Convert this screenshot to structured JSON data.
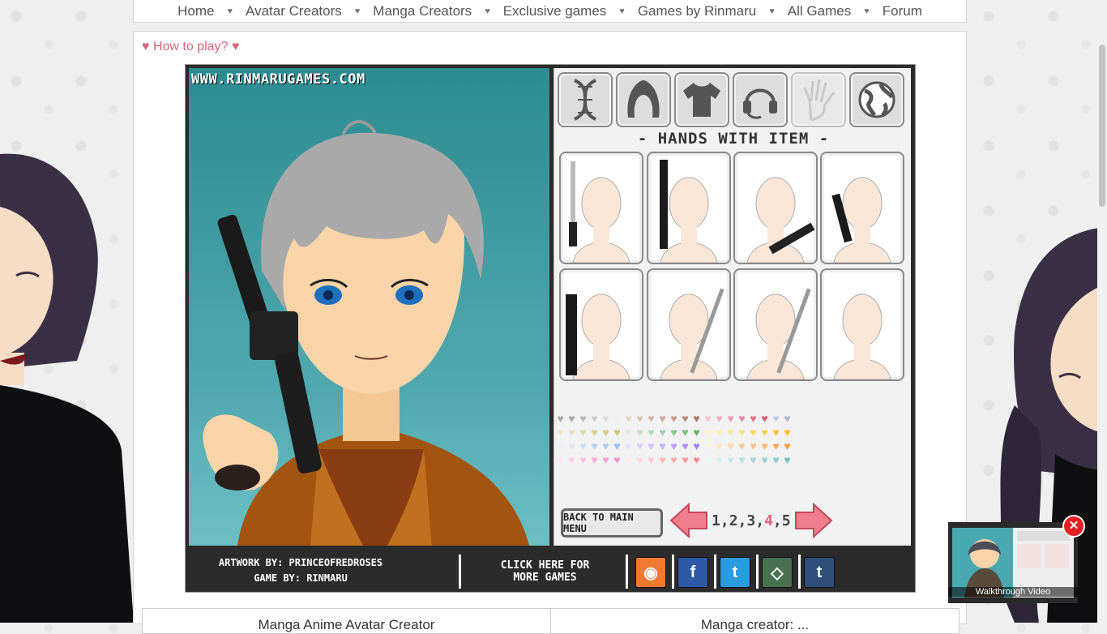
{
  "nav": {
    "items": [
      "Home",
      "Avatar Creators",
      "Manga Creators",
      "Exclusive games",
      "Games by Rinmaru",
      "All Games",
      "Forum"
    ],
    "separator": "♥"
  },
  "howto": "♥ How to play? ♥",
  "game": {
    "watermark": "WWW.RINMARUGAMES.COM",
    "categories": [
      {
        "icon": "dna-icon"
      },
      {
        "icon": "hair-icon"
      },
      {
        "icon": "shirt-icon"
      },
      {
        "icon": "headset-icon"
      },
      {
        "icon": "hand-icon",
        "dim": true
      },
      {
        "icon": "globe-icon"
      }
    ],
    "section_title": "- HANDS WITH ITEM -",
    "slots": [
      {
        "item": "lightsaber"
      },
      {
        "item": "staff"
      },
      {
        "item": "rifle"
      },
      {
        "item": "blaster"
      },
      {
        "item": "gun-rifle"
      },
      {
        "item": "katana"
      },
      {
        "item": "sword"
      },
      {
        "item": "none"
      }
    ],
    "back_button": "BACK TO MAIN MENU",
    "pages": [
      "1",
      "2",
      "3",
      "4",
      "5"
    ],
    "current_page": "4",
    "credits": {
      "artwork": "ARTWORK BY: PRINCEOFREDROSES",
      "game": "GAME BY: RINMARU"
    },
    "more_games": "CLICK HERE FOR MORE GAMES"
  },
  "social": [
    {
      "name": "camera-icon",
      "color": "#f07a30",
      "glyph": "◉"
    },
    {
      "name": "facebook-icon",
      "color": "#2d5aa8",
      "glyph": "f"
    },
    {
      "name": "twitter-icon",
      "color": "#2b9be0",
      "glyph": "t"
    },
    {
      "name": "deviantart-icon",
      "color": "#47714f",
      "glyph": "◇"
    },
    {
      "name": "tumblr-icon",
      "color": "#2f4e79",
      "glyph": "t"
    }
  ],
  "bottom_table": [
    "Manga Anime Avatar Creator",
    "Manga creator: ..."
  ],
  "video": {
    "caption": "Walkthrough Video",
    "close": "✕"
  },
  "colors": {
    "accent": "#d9667b",
    "stage_top": "#2c8c91",
    "stage_bottom": "#6cc0c5"
  }
}
